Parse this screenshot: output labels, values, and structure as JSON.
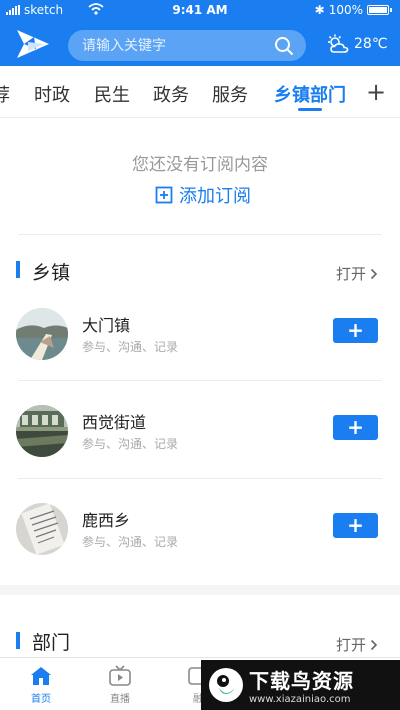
{
  "status": {
    "carrier": "sketch",
    "time": "9:41 AM",
    "battery": "100%"
  },
  "header": {
    "search_placeholder": "请输入关键字",
    "weather": "28℃"
  },
  "tabs": [
    {
      "label": "荐"
    },
    {
      "label": "时政"
    },
    {
      "label": "民生"
    },
    {
      "label": "政务"
    },
    {
      "label": "服务"
    },
    {
      "label": "乡镇部门"
    }
  ],
  "tab_add": "+",
  "empty": {
    "message": "您还没有订阅内容",
    "add_label": "添加订阅"
  },
  "section_township": {
    "title": "乡镇",
    "open_label": "打开"
  },
  "rows": [
    {
      "name": "大门镇",
      "desc": "参与、沟通、记录",
      "button": "+"
    },
    {
      "name": "西觉街道",
      "desc": "参与、沟通、记录",
      "button": "+"
    },
    {
      "name": "鹿西乡",
      "desc": "参与、沟通、记录",
      "button": "+"
    }
  ],
  "section_dept": {
    "title": "部门",
    "open_label": "打开"
  },
  "bottomnav": [
    {
      "label": "首页"
    },
    {
      "label": "直播"
    },
    {
      "label": "融"
    }
  ],
  "watermark": {
    "title": "下载鸟资源",
    "url": "www.xiazainiao.com"
  },
  "colors": {
    "primary": "#1a7ef0",
    "search_bg": "#5aa3f5"
  }
}
